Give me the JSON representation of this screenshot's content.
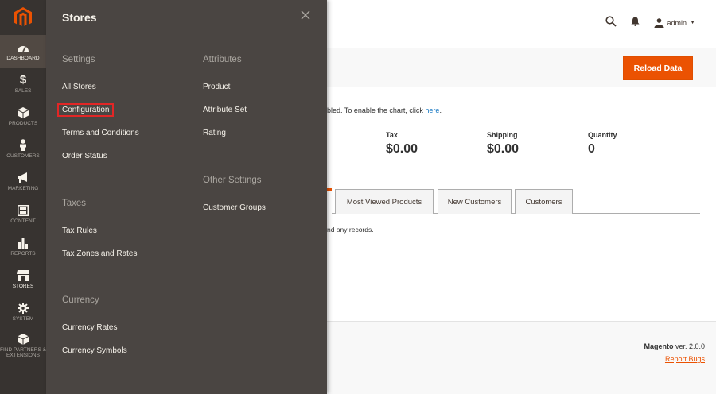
{
  "colors": {
    "accent": "#eb5202",
    "nav_bg": "#373330",
    "flyout_bg": "#4a4542",
    "highlight": "#e22626"
  },
  "nav": {
    "items": [
      {
        "label": "DASHBOARD",
        "icon": "dashboard-icon"
      },
      {
        "label": "SALES",
        "icon": "dollar-icon"
      },
      {
        "label": "PRODUCTS",
        "icon": "cube-icon"
      },
      {
        "label": "CUSTOMERS",
        "icon": "person-icon"
      },
      {
        "label": "MARKETING",
        "icon": "megaphone-icon"
      },
      {
        "label": "CONTENT",
        "icon": "layout-icon"
      },
      {
        "label": "REPORTS",
        "icon": "bar-chart-icon"
      },
      {
        "label": "STORES",
        "icon": "storefront-icon"
      },
      {
        "label": "SYSTEM",
        "icon": "gear-icon"
      },
      {
        "label": "FIND PARTNERS & EXTENSIONS",
        "icon": "box-icon"
      }
    ]
  },
  "flyout": {
    "title": "Stores",
    "settings": {
      "heading": "Settings",
      "links": [
        "All Stores",
        "Configuration",
        "Terms and Conditions",
        "Order Status"
      ]
    },
    "taxes": {
      "heading": "Taxes",
      "links": [
        "Tax Rules",
        "Tax Zones and Rates"
      ]
    },
    "currency": {
      "heading": "Currency",
      "links": [
        "Currency Rates",
        "Currency Symbols"
      ]
    },
    "attributes": {
      "heading": "Attributes",
      "links": [
        "Product",
        "Attribute Set",
        "Rating"
      ]
    },
    "other": {
      "heading": "Other Settings",
      "links": [
        "Customer Groups"
      ]
    }
  },
  "header": {
    "user": "admin"
  },
  "toolbar": {
    "reload_label": "Reload Data"
  },
  "chart_message": {
    "text": "bled. To enable the chart, click ",
    "link": "here",
    "end": "."
  },
  "totals": [
    {
      "label": "Tax",
      "value": "$0.00"
    },
    {
      "label": "Shipping",
      "value": "$0.00"
    },
    {
      "label": "Quantity",
      "value": "0"
    }
  ],
  "tabs": [
    "Most Viewed Products",
    "New Customers",
    "Customers"
  ],
  "records_text": "nd any records.",
  "footer": {
    "brand": "Magento",
    "version": " ver. 2.0.0",
    "report_link": "Report Bugs"
  }
}
